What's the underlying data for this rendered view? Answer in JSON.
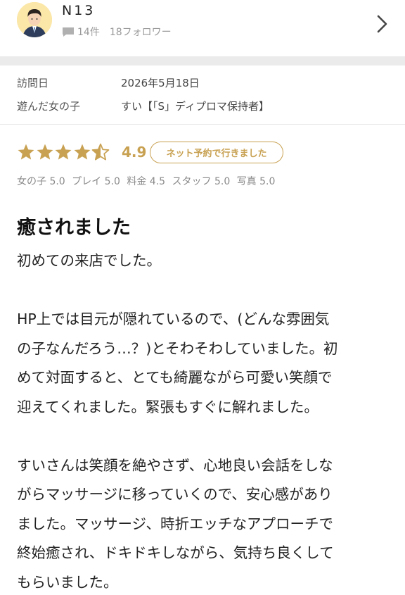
{
  "user": {
    "name": "N13",
    "post_count": "14件",
    "followers": "18フォロワー"
  },
  "visit": {
    "date_label": "訪問日",
    "date_value": "2026年5月18日",
    "girl_label": "遊んだ女の子",
    "girl_value": "すい【「S」ディプロマ保持者】"
  },
  "rating": {
    "stars": 4.5,
    "score": "4.9",
    "badge": "ネット予約で行きました",
    "star_color": "#c8a152",
    "sub_scores": [
      "女の子 5.0",
      "プレイ 5.0",
      "料金 4.5",
      "スタッフ 5.0",
      "写真 5.0"
    ]
  },
  "review": {
    "title": "癒されました",
    "lines": [
      "初めての来店でした。",
      "",
      "HP上では目元が隠れているので、(どんな雰囲気",
      "の子なんだろう…？)とそわそわしていました。初",
      "めて対面すると、とても綺麗ながら可愛い笑顔で",
      "迎えてくれました。緊張もすぐに解れました。",
      "",
      "すいさんは笑顔を絶やさず、心地良い会話をしな",
      "がらマッサージに移っていくので、安心感があり",
      "ました。マッサージ、時折エッチなアプローチで",
      "終始癒され、ドキドキしながら、気持ち良くして",
      "もらいました。"
    ]
  },
  "icons": {
    "avatar": "user-avatar-icon",
    "comment": "comment-icon",
    "chevron": "chevron-right-icon"
  }
}
